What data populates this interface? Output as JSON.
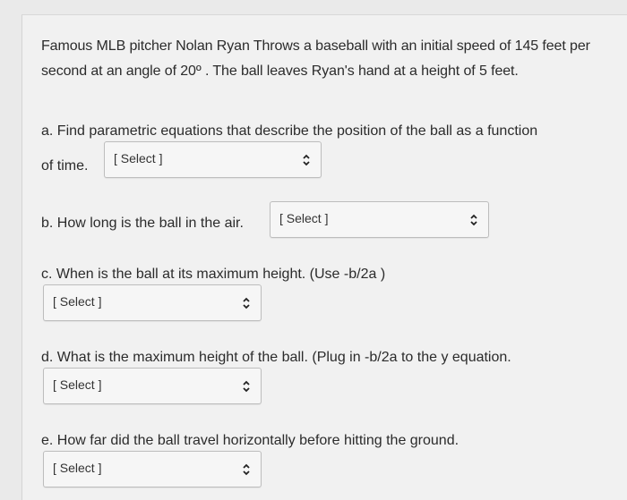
{
  "intro": "Famous MLB pitcher Nolan Ryan Throws a baseball with an initial speed of 145 feet per second at an angle of 20º . The ball leaves Ryan's hand at a height of 5 feet.",
  "questions": [
    {
      "prompt": "a. Find parametric equations that describe the position of the ball as a function",
      "prompt_cont": "of time.",
      "select": "[ Select ]"
    },
    {
      "prompt": "b. How long is the ball in the air.",
      "select": "[ Select ]"
    },
    {
      "prompt": "c. When is the ball at its maximum height. (Use -b/2a )",
      "select": "[ Select ]"
    },
    {
      "prompt": "d. What is the maximum height of the ball. (Plug in -b/2a to the y equation.",
      "select": "[ Select ]"
    },
    {
      "prompt": "e. How far did the ball travel horizontally before hitting the ground.",
      "select": "[ Select ]"
    }
  ],
  "icons": {
    "dropdown": "chevron-up-down-icon"
  }
}
